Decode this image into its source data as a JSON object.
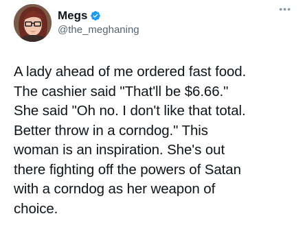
{
  "author": {
    "display_name": "Megs",
    "handle": "@the_meghaning",
    "verified": true,
    "avatar_icon": "profile-avatar"
  },
  "more_icon": "more-options-icon",
  "tweet": {
    "lines": [
      "A lady ahead of me ordered fast food.",
      "The cashier said \"That'll be $6.66.\"",
      "She said \"Oh no. I don't like that total.",
      "Better throw in a corndog.\" This",
      "woman is an inspiration. She's out",
      "there fighting off the powers of Satan",
      "with a corndog as her weapon of",
      "choice."
    ]
  },
  "colors": {
    "text": "#0f1419",
    "secondary": "#536471",
    "verified_blue": "#1d9bf0"
  }
}
